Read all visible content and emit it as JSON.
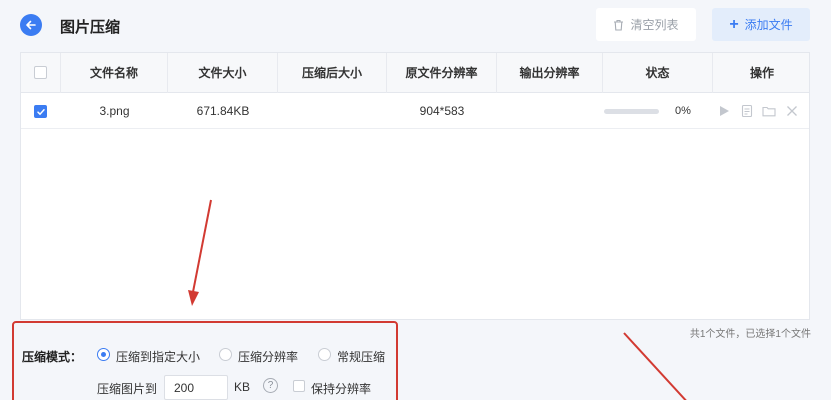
{
  "header": {
    "title": "图片压缩",
    "clear_label": "清空列表",
    "add_label": "添加文件"
  },
  "table": {
    "columns": [
      "文件名称",
      "文件大小",
      "压缩后大小",
      "原文件分辨率",
      "输出分辨率",
      "状态",
      "操作"
    ],
    "rows": [
      {
        "checked": true,
        "name": "3.png",
        "size": "671.84KB",
        "compressed_size": "",
        "original_resolution": "904*583",
        "output_resolution": "",
        "progress": 0,
        "progress_text": "0%"
      }
    ]
  },
  "summary": "共1个文件，已选择1个文件",
  "settings": {
    "mode_label": "压缩模式：",
    "modes": [
      {
        "label": "压缩到指定大小",
        "selected": true
      },
      {
        "label": "压缩分辨率",
        "selected": false
      },
      {
        "label": "常规压缩",
        "selected": false
      }
    ],
    "size_label": "压缩图片到",
    "size_value": "200",
    "size_unit": "KB",
    "help_symbol": "?",
    "keep_resolution_label": "保持分辨率",
    "keep_resolution": false
  },
  "colors": {
    "accent": "#3b7cf2",
    "highlight": "#d23a32"
  },
  "icons": {
    "back": "arrow-left-icon",
    "clear": "trash-icon",
    "add": "plus-icon",
    "ops": [
      "play-icon",
      "document-icon",
      "folder-icon",
      "close-icon"
    ]
  }
}
